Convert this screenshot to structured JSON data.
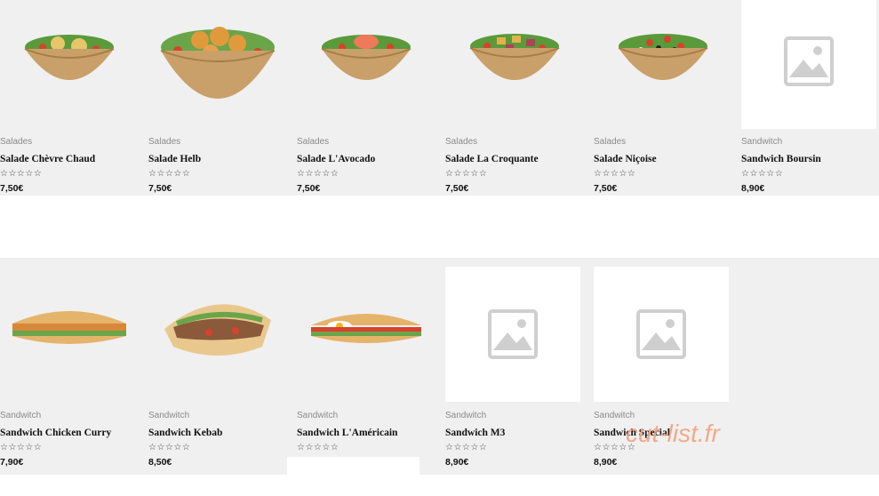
{
  "products_row1": [
    {
      "category": "Salades",
      "name": "Salade Chèvre Chaud",
      "rating_label": "☆☆☆☆☆",
      "price": "7,50€",
      "image": "salad-bowl-image",
      "placeholder": false
    },
    {
      "category": "Salades",
      "name": "Salade Helb",
      "rating_label": "☆☆☆☆☆",
      "price": "7,50€",
      "image": "salad-bowl-image",
      "placeholder": false
    },
    {
      "category": "Salades",
      "name": "Salade L'Avocado",
      "rating_label": "☆☆☆☆☆",
      "price": "7,50€",
      "image": "salad-bowl-image",
      "placeholder": false
    },
    {
      "category": "Salades",
      "name": "Salade La Croquante",
      "rating_label": "☆☆☆☆☆",
      "price": "7,50€",
      "image": "salad-bowl-image",
      "placeholder": false
    },
    {
      "category": "Salades",
      "name": "Salade Niçoise",
      "rating_label": "☆☆☆☆☆",
      "price": "7,50€",
      "image": "salad-bowl-image",
      "placeholder": false
    },
    {
      "category": "Sandwitch",
      "name": "Sandwich Boursin",
      "rating_label": "☆☆☆☆☆",
      "price": "8,90€",
      "image": "placeholder-image-icon",
      "placeholder": true
    }
  ],
  "products_row2": [
    {
      "category": "Sandwitch",
      "name": "Sandwich Chicken Curry",
      "rating_label": "☆☆☆☆☆",
      "price": "7,90€",
      "image": "sandwich-image",
      "placeholder": false
    },
    {
      "category": "Sandwitch",
      "name": "Sandwich Kebab",
      "rating_label": "☆☆☆☆☆",
      "price": "8,50€",
      "image": "kebab-image",
      "placeholder": false
    },
    {
      "category": "Sandwitch",
      "name": "Sandwich L'Américain",
      "rating_label": "☆☆☆☆☆",
      "price": "",
      "image": "sandwich-image",
      "placeholder": false
    },
    {
      "category": "Sandwitch",
      "name": "Sandwich M3",
      "rating_label": "☆☆☆☆☆",
      "price": "8,90€",
      "image": "placeholder-image-icon",
      "placeholder": true
    },
    {
      "category": "Sandwitch",
      "name": "Sandwich Special",
      "rating_label": "☆☆☆☆☆",
      "price": "8,90€",
      "image": "placeholder-image-icon",
      "placeholder": true
    }
  ],
  "watermark": "cut-list.fr",
  "colors": {
    "band_bg": "#f0f0f0",
    "watermark": "#f2a27e",
    "placeholder_icon": "#cfcfcf"
  }
}
